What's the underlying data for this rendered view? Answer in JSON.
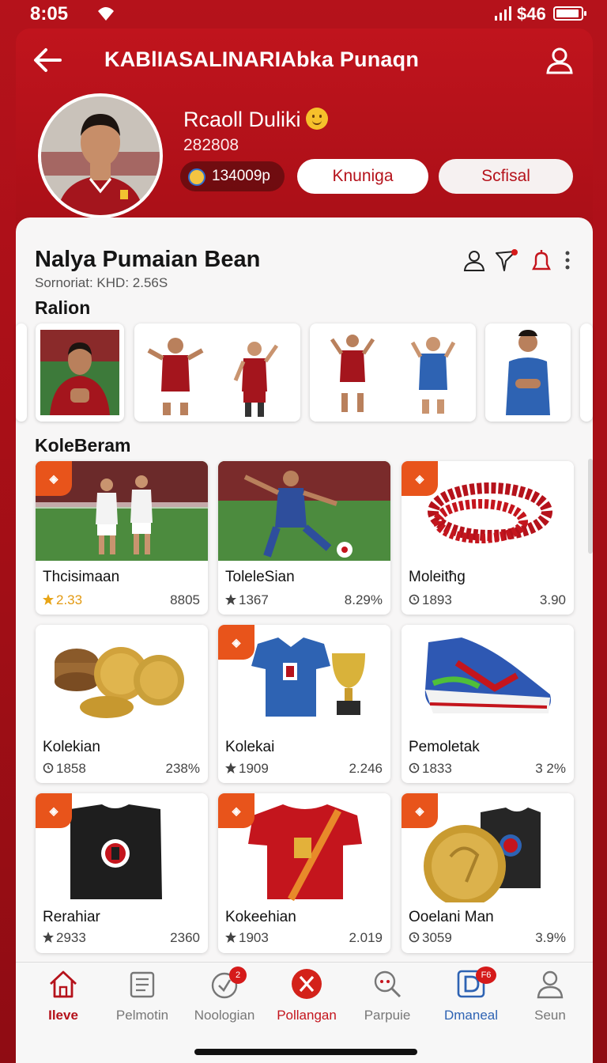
{
  "status_bar": {
    "time": "8:05",
    "carrier": "$46"
  },
  "header": {
    "title": "KABlIASALINARIAbka Punaqn"
  },
  "profile": {
    "name": "Rcaoll Duliki",
    "id": "282808",
    "coins": "134009p",
    "button_a": "Knuniga",
    "button_b": "Scfisal"
  },
  "section": {
    "title": "Nalya Pumaian Bean",
    "subtitle": "Sornoriat:  KHD:  2.56S"
  },
  "players_label": "Ralion",
  "collection_label": "KoleBeram",
  "collection": [
    {
      "name": "Thcisimaan",
      "stat": "2.33",
      "value": "8805",
      "stat_icon": "star-icon",
      "highlight": true
    },
    {
      "name": "ToleleSian",
      "stat": "1367",
      "value": "8.29%",
      "stat_icon": "star-icon"
    },
    {
      "name": "Moleitħg",
      "stat": "1893",
      "value": "3.90",
      "stat_icon": "clock-icon"
    },
    {
      "name": "Kolekian",
      "stat": "1858",
      "value": "238%",
      "stat_icon": "clock-icon"
    },
    {
      "name": "Kolekai",
      "stat": "1909",
      "value": "2.246",
      "stat_icon": "star-icon"
    },
    {
      "name": "Pemoletak",
      "stat": "1833",
      "value": "3 2%",
      "stat_icon": "clock-icon"
    },
    {
      "name": "Rerahiar",
      "stat": "2933",
      "value": "2360",
      "stat_icon": "star-icon"
    },
    {
      "name": "Kokeehian",
      "stat": "1903",
      "value": "2.019",
      "stat_icon": "star-icon"
    },
    {
      "name": "Ooelani Man",
      "stat": "3059",
      "value": "3.9%",
      "stat_icon": "clock-icon"
    }
  ],
  "badges": {
    "notifications": "2",
    "donations": "F6"
  },
  "nav": [
    {
      "label": "Ileve",
      "icon": "home-icon",
      "active": true
    },
    {
      "label": "Pelmotin",
      "icon": "list-icon"
    },
    {
      "label": "Noologian",
      "icon": "check-icon"
    },
    {
      "label": "Pollangan",
      "icon": "x-circle-icon",
      "active": true
    },
    {
      "label": "Parpuie",
      "icon": "search-icon"
    },
    {
      "label": "Dmaneal",
      "icon": "d-icon"
    },
    {
      "label": "Seun",
      "icon": "user-icon"
    }
  ],
  "colors": {
    "brand_red": "#b5121b",
    "accent_orange": "#e8541b",
    "blue": "#2e63b3"
  }
}
